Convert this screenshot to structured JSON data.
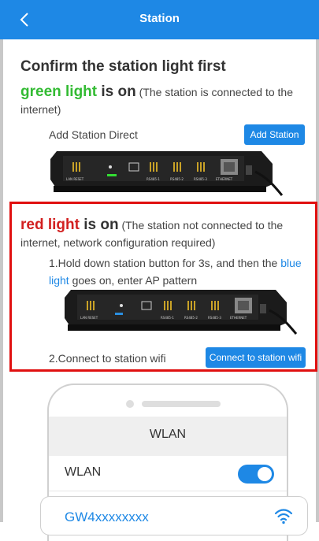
{
  "header": {
    "title": "Station"
  },
  "heading": "Confirm the station light first",
  "green_section": {
    "highlight": "green light",
    "is_on": " is on",
    "note": " (The station is connected to the internet)",
    "row_label": "Add Station Direct",
    "button_label": "Add Station"
  },
  "red_section": {
    "highlight": "red light",
    "is_on": " is on",
    "note": " (The station not connected to the internet, network configuration required)",
    "step1_prefix": "1.Hold down station button for 3s, and then the ",
    "step1_highlight": "blue light",
    "step1_suffix": " goes on, enter AP pattern",
    "step2_label": "2.Connect to station wifi",
    "button_label": "Connect to station wifi"
  },
  "device_labels": {
    "lan": "LAN RESET",
    "ports": [
      "RS485-1",
      "RS485-2",
      "RS485-3"
    ],
    "eth": "ETHERNET"
  },
  "phone": {
    "wlan_title": "WLAN",
    "wlan_label": "WLAN",
    "toggle_on": true,
    "network_name": "GW4xxxxxxxx"
  },
  "colors": {
    "primary": "#1e88e5",
    "green": "#33bb33",
    "red": "#d22020",
    "box_border": "#e01010"
  }
}
